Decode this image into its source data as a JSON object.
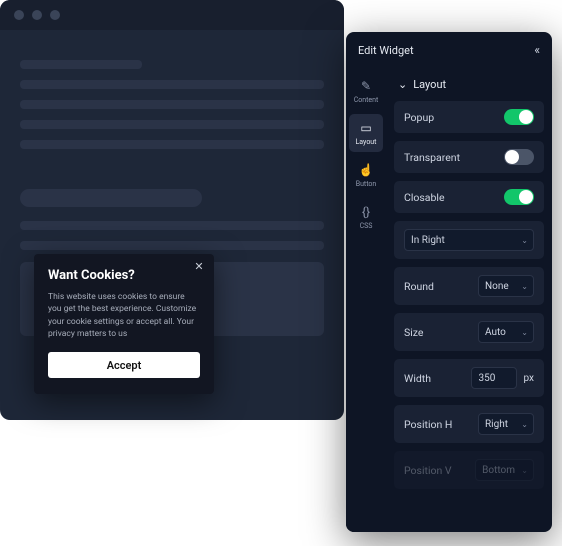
{
  "cookie": {
    "title": "Want Cookies?",
    "body": "This website uses cookies to ensure you get the best experience. Customize your cookie settings or accept all. Your privacy matters to us",
    "accept": "Accept"
  },
  "panel": {
    "title": "Edit Widget",
    "tabs": {
      "content": "Content",
      "layout": "Layout",
      "button": "Button",
      "css": "CSS"
    },
    "section": "Layout",
    "props": {
      "popup": {
        "label": "Popup",
        "value": true
      },
      "transparent": {
        "label": "Transparent",
        "value": false
      },
      "closable": {
        "label": "Closable",
        "value": true
      },
      "animation": {
        "value": "In Right"
      },
      "round": {
        "label": "Round",
        "value": "None"
      },
      "size": {
        "label": "Size",
        "value": "Auto"
      },
      "width": {
        "label": "Width",
        "value": "350",
        "unit": "px"
      },
      "posh": {
        "label": "Position H",
        "value": "Right"
      },
      "posv": {
        "label": "Position V",
        "value": "Bottom"
      }
    }
  }
}
